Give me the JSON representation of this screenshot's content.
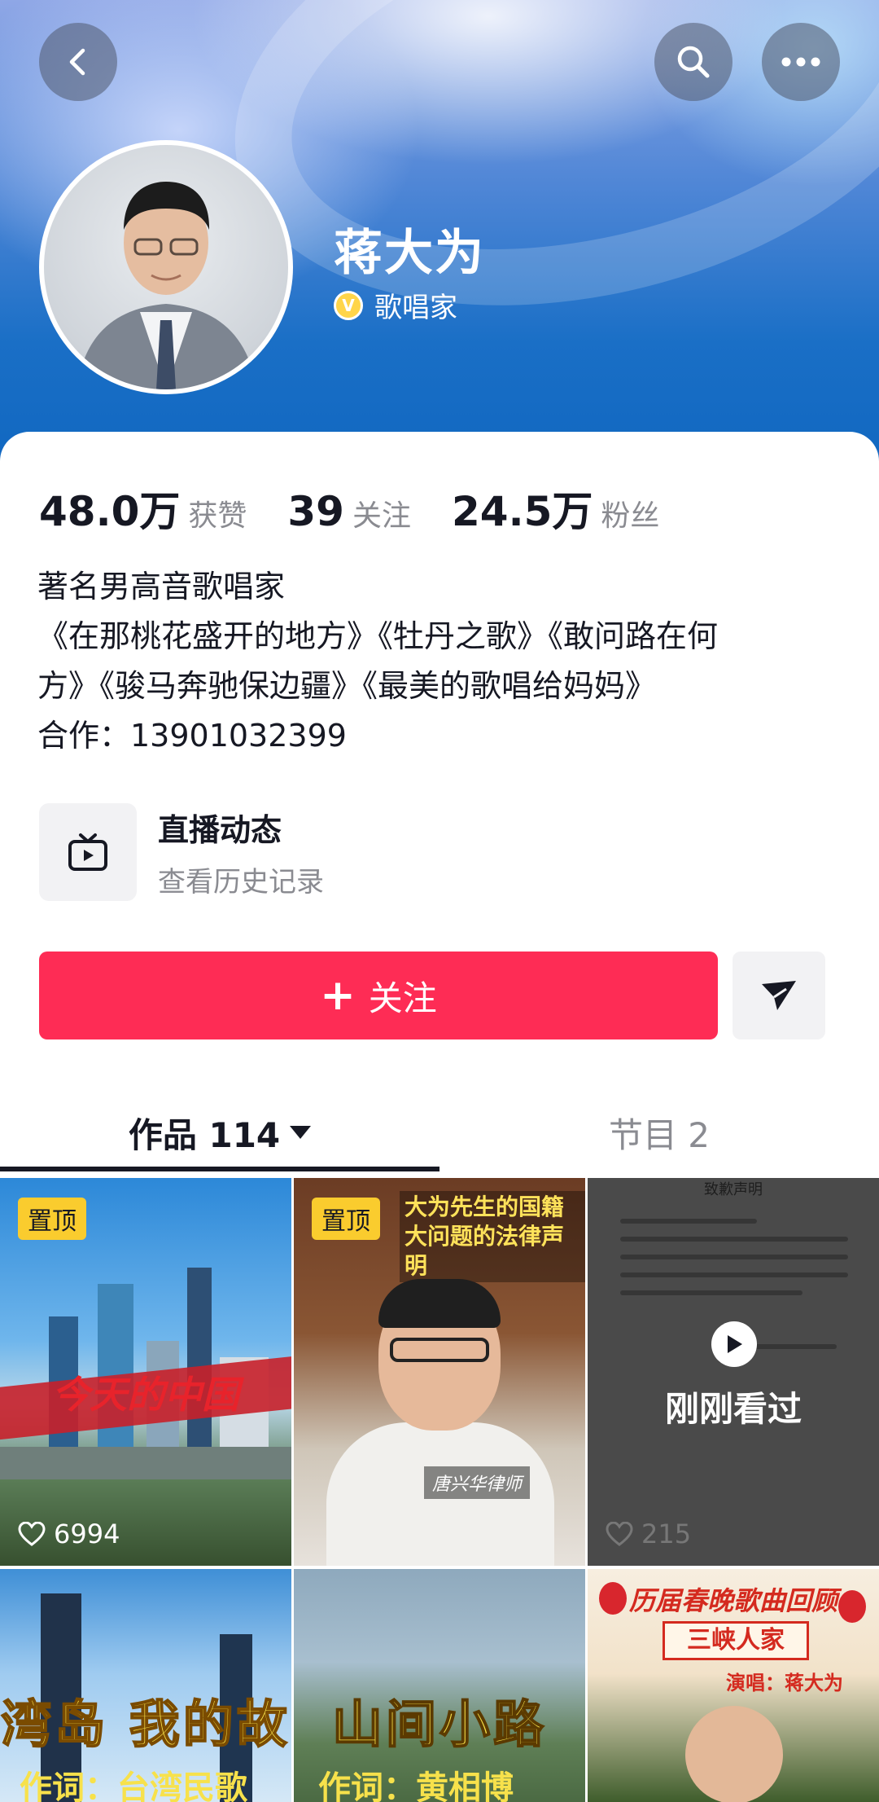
{
  "profile": {
    "name": "蒋大为",
    "verified_label": "歌唱家",
    "verified_badge": "V"
  },
  "stats": [
    {
      "value": "48.0万",
      "label": "获赞"
    },
    {
      "value": "39",
      "label": "关注"
    },
    {
      "value": "24.5万",
      "label": "粉丝"
    }
  ],
  "bio": {
    "line1": "著名男高音歌唱家",
    "line2": "《在那桃花盛开的地方》《牡丹之歌》《敢问路在何",
    "line3": "方》《骏马奔驰保边疆》《最美的歌唱给妈妈》",
    "line4": "合作：13901032399"
  },
  "live": {
    "title": "直播动态",
    "subtitle": "查看历史记录"
  },
  "actions": {
    "follow_plus": "+",
    "follow_label": "关注"
  },
  "tabs": {
    "works_label": "作品 114",
    "shows_label": "节目 2"
  },
  "videos": [
    {
      "pinned": "置顶",
      "likes": "6994",
      "title": "今天的中国"
    },
    {
      "pinned": "置顶",
      "headline": "大为先生的国籍 大问题的法律声明",
      "tag": "唐兴华律师"
    },
    {
      "doc_title": "致歉声明",
      "overlay": "刚刚看过",
      "likes": "215"
    },
    {
      "title": "湾岛 我的故",
      "subtitle": "作词：台湾民歌"
    },
    {
      "title": "山间小路",
      "subtitle": "作词：黄相博"
    },
    {
      "header": "历届春晚歌曲回顾",
      "song": "三峡人家",
      "singer": "演唱：蒋大为"
    }
  ],
  "colors": {
    "accent": "#fe2c55",
    "pin": "#facc2e",
    "header_blue": "#1a6fc6"
  },
  "icons": {
    "back": "chevron-left-icon",
    "search": "search-icon",
    "more": "more-dots-icon",
    "live": "tv-icon",
    "share": "paper-plane-icon",
    "like": "heart-icon",
    "play": "play-icon"
  }
}
